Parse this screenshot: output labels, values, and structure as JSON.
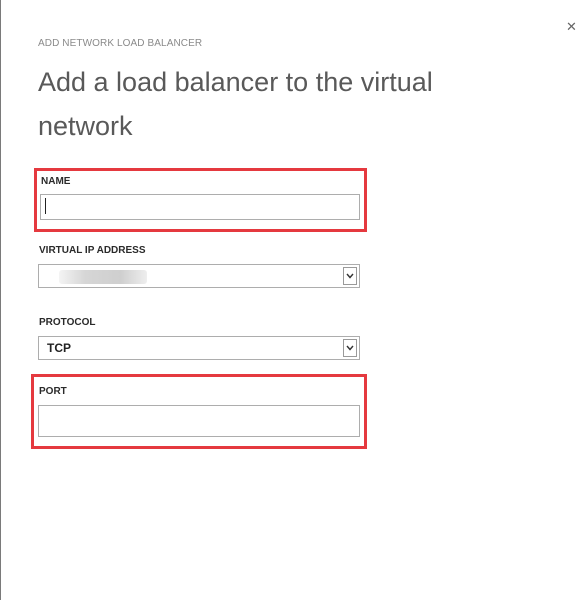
{
  "dialog": {
    "subtitle": "ADD NETWORK LOAD BALANCER",
    "title": "Add a load balancer to the virtual network",
    "close_icon": "close-icon"
  },
  "fields": {
    "name": {
      "label": "NAME",
      "value": "",
      "placeholder": ""
    },
    "virtual_ip": {
      "label": "VIRTUAL IP ADDRESS",
      "value": "",
      "icon": "chevron-down-icon"
    },
    "protocol": {
      "label": "PROTOCOL",
      "value": "TCP",
      "icon": "chevron-down-icon"
    },
    "port": {
      "label": "PORT",
      "value": "",
      "placeholder": ""
    }
  },
  "colors": {
    "highlight": "#e5393f",
    "border": "#adadad"
  }
}
